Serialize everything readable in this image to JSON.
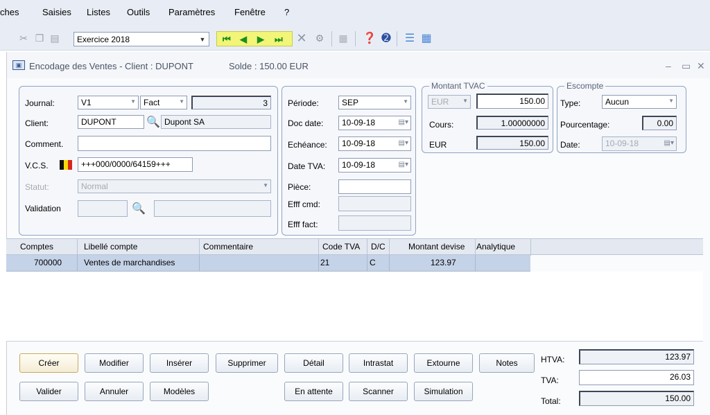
{
  "menu": [
    "ches",
    "Saisies",
    "Listes",
    "Outils",
    "Paramètres",
    "Fenêtre",
    "?"
  ],
  "toolbar": {
    "exercise": "Exercice 2018"
  },
  "window": {
    "title": "Encodage des Ventes - Client : DUPONT",
    "solde": "Solde : 150.00 EUR"
  },
  "left": {
    "journal_label": "Journal:",
    "journal_value": "V1",
    "type_value": "Fact",
    "number_value": "3",
    "client_label": "Client:",
    "client_value": "DUPONT",
    "client_name": "Dupont SA",
    "comment_label": "Comment.",
    "comment_value": "",
    "vcs_label": "V.C.S.",
    "vcs_value": "+++000/0000/64159+++",
    "statut_label": "Statut:",
    "statut_value": "Normal",
    "validation_label": "Validation"
  },
  "middle": {
    "periode_label": "Période:",
    "periode_value": "SEP",
    "docdate_label": "Doc date:",
    "docdate_value": "10-09-18",
    "echeance_label": "Echéance:",
    "echeance_value": "10-09-18",
    "datetva_label": "Date TVA:",
    "datetva_value": "10-09-18",
    "piece_label": "Pièce:",
    "effcmd_label": "Efff cmd:",
    "efffact_label": "Efff fact:"
  },
  "montant": {
    "title": "Montant TVAC",
    "currency": "EUR",
    "amount": "150.00",
    "cours_label": "Cours:",
    "cours_value": "1.00000000",
    "eur_label": "EUR",
    "eur_value": "150.00"
  },
  "escompte": {
    "title": "Escompte",
    "type_label": "Type:",
    "type_value": "Aucun",
    "pct_label": "Pourcentage:",
    "pct_value": "0.00",
    "date_label": "Date:",
    "date_value": "10-09-18"
  },
  "grid": {
    "headers": [
      "Comptes",
      "Libellé compte",
      "Commentaire",
      "Code TVA",
      "D/C",
      "Montant devise",
      "Analytique"
    ],
    "row": {
      "compte": "700000",
      "libelle": "Ventes de marchandises",
      "commentaire": "",
      "code_tva": "21",
      "dc": "C",
      "montant": "123.97",
      "analytique": ""
    }
  },
  "buttons": {
    "creer": "Créer",
    "modifier": "Modifier",
    "inserer": "Insérer",
    "supprimer": "Supprimer",
    "detail": "Détail",
    "intrastat": "Intrastat",
    "extourne": "Extourne",
    "notes": "Notes",
    "valider": "Valider",
    "annuler": "Annuler",
    "modeles": "Modèles",
    "en_attente": "En attente",
    "scanner": "Scanner",
    "simulation": "Simulation"
  },
  "totals": {
    "htva_label": "HTVA:",
    "htva_value": "123.97",
    "tva_label": "TVA:",
    "tva_value": "26.03",
    "total_label": "Total:",
    "total_value": "150.00"
  }
}
